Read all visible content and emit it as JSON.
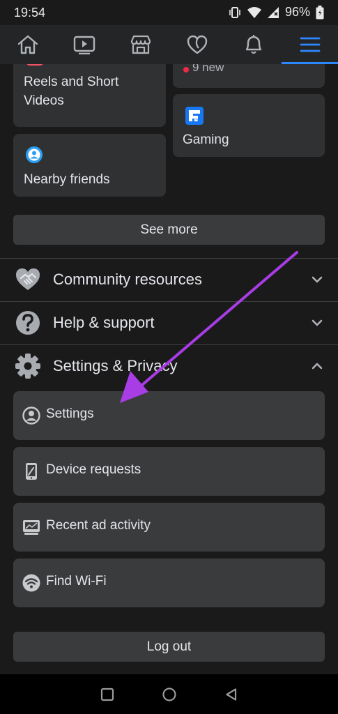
{
  "status_bar": {
    "time": "19:54",
    "battery": "96%"
  },
  "nav": {
    "tabs": [
      {
        "name": "home",
        "icon": "home-icon"
      },
      {
        "name": "watch",
        "icon": "video-icon"
      },
      {
        "name": "marketplace",
        "icon": "store-icon"
      },
      {
        "name": "dating",
        "icon": "heart-icon"
      },
      {
        "name": "notifications",
        "icon": "bell-icon"
      },
      {
        "name": "menu",
        "icon": "menu-icon",
        "active": true
      }
    ],
    "accent": "#2d88ff"
  },
  "shortcuts": {
    "reels_label": "Reels and Short Videos",
    "nearby_label": "Nearby friends",
    "partial_badge": "9 new",
    "gaming_label": "Gaming"
  },
  "see_more_label": "See more",
  "sections": {
    "community": "Community resources",
    "help": "Help & support",
    "settings_privacy": "Settings & Privacy"
  },
  "settings_items": [
    {
      "label": "Settings",
      "icon": "user-circle-icon"
    },
    {
      "label": "Device requests",
      "icon": "phone-icon"
    },
    {
      "label": "Recent ad activity",
      "icon": "ad-activity-icon"
    },
    {
      "label": "Find Wi-Fi",
      "icon": "wifi-icon"
    }
  ],
  "logout_label": "Log out",
  "annotation": {
    "arrow_color": "#a93de5"
  }
}
